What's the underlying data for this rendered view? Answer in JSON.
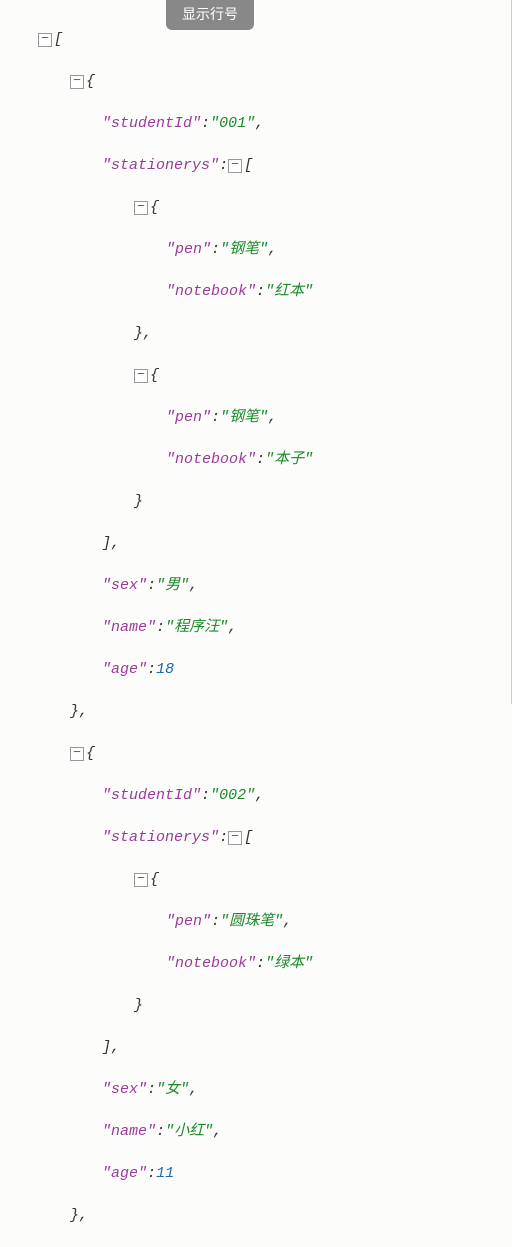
{
  "toolbar": {
    "show_line_numbers": "显示行号"
  },
  "glyph": {
    "minus": "−"
  },
  "p": {
    "lb": "[",
    "rb": "]",
    "lc": "{",
    "rc": "}",
    "q": "\"",
    "colon": ":",
    "comma": ","
  },
  "k": {
    "studentId": "studentId",
    "stationerys": "stationerys",
    "pen": "pen",
    "notebook": "notebook",
    "sex": "sex",
    "name": "name",
    "age": "age"
  },
  "students": [
    {
      "studentId": "001",
      "stationerys": [
        {
          "pen": "钢笔",
          "notebook": "红本"
        },
        {
          "pen": "钢笔",
          "notebook": "本子"
        }
      ],
      "sex": "男",
      "name": "程序汪",
      "age": 18
    },
    {
      "studentId": "002",
      "stationerys": [
        {
          "pen": "圆珠笔",
          "notebook": "绿本"
        }
      ],
      "sex": "女",
      "name": "小红",
      "age": 11
    }
  ]
}
